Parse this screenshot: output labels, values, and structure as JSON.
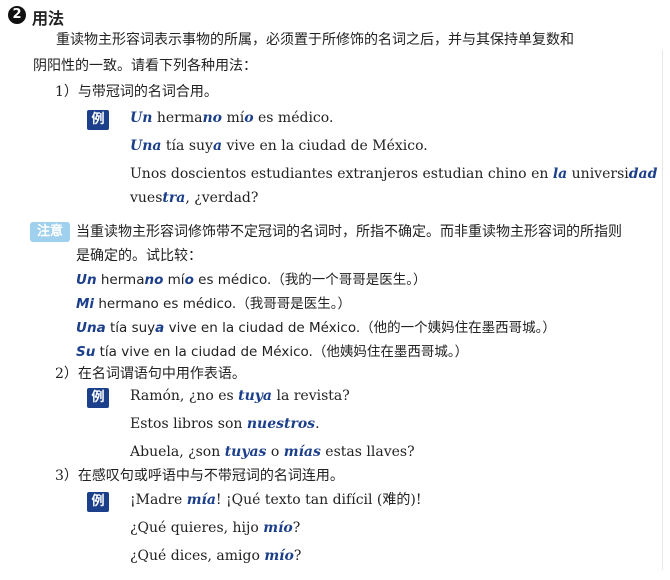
{
  "section": {
    "number": "2",
    "title": "用法"
  },
  "intro": {
    "line1": "重读物主形容词表示事物的所属，必须置于所修饰的名词之后，并与其保持单复数和",
    "line2": "阴阳性的一致。请看下列各种用法："
  },
  "badges": {
    "example": "例",
    "note": "注意"
  },
  "point1": {
    "heading": "1）与带冠词的名词合用。"
  },
  "ex1": {
    "s1": [
      {
        "t": "Un",
        "h": true
      },
      {
        "t": " herma"
      },
      {
        "t": "no",
        "h": true
      },
      {
        "t": " mí"
      },
      {
        "t": "o",
        "h": true
      },
      {
        "t": " es médico."
      }
    ],
    "s2": [
      {
        "t": "Una",
        "h": true
      },
      {
        "t": " tía suy"
      },
      {
        "t": "a",
        "h": true
      },
      {
        "t": " vive en la ciudad de México."
      }
    ],
    "s3a": [
      {
        "t": "Unos doscientos estudiantes extranjeros estudian chino en "
      },
      {
        "t": "la",
        "h": true
      },
      {
        "t": " universi"
      },
      {
        "t": "dad",
        "h": true
      }
    ],
    "s3b": [
      {
        "t": "vues"
      },
      {
        "t": "tra",
        "h": true
      },
      {
        "t": ", ¿verdad?"
      }
    ]
  },
  "note": {
    "line1": "当重读物主形容词修饰带不定冠词的名词时，所指不确定。而非重读物主形容词的所指则",
    "line2": "是确定的。试比较：",
    "c1": [
      {
        "t": "Un",
        "h": true
      },
      {
        "t": " herma"
      },
      {
        "t": "no",
        "h": true
      },
      {
        "t": " mí"
      },
      {
        "t": "o",
        "h": true
      },
      {
        "t": " es médico.（我的一个哥哥是医生。）"
      }
    ],
    "c2": [
      {
        "t": "Mi",
        "h": true
      },
      {
        "t": " hermano es médico.（我哥哥是医生。）"
      }
    ],
    "c3": [
      {
        "t": "Una",
        "h": true
      },
      {
        "t": " tía suy"
      },
      {
        "t": "a",
        "h": true
      },
      {
        "t": " vive en la ciudad de México.（他的一个姨妈住在墨西哥城。）"
      }
    ],
    "c4": [
      {
        "t": "Su",
        "h": true
      },
      {
        "t": " tía vive en la ciudad de México.（他姨妈住在墨西哥城。）"
      }
    ]
  },
  "point2": {
    "heading": "2）在名词谓语句中用作表语。"
  },
  "ex2": {
    "s1": [
      {
        "t": "Ramón, ¿no es "
      },
      {
        "t": "tuya",
        "h": true
      },
      {
        "t": " la revista?"
      }
    ],
    "s2": [
      {
        "t": "Estos libros son "
      },
      {
        "t": "nuestros",
        "h": true
      },
      {
        "t": "."
      }
    ],
    "s3": [
      {
        "t": "Abuela, ¿son "
      },
      {
        "t": "tuyas",
        "h": true
      },
      {
        "t": " o "
      },
      {
        "t": "mías",
        "h": true
      },
      {
        "t": " estas llaves?"
      }
    ]
  },
  "point3": {
    "heading": "3）在感叹句或呼语中与不带冠词的名词连用。"
  },
  "ex3": {
    "s1": [
      {
        "t": "¡Madre "
      },
      {
        "t": "mía",
        "h": true
      },
      {
        "t": "! ¡Qué texto tan difícil (难的)!"
      }
    ],
    "s2": [
      {
        "t": "¿Qué quieres, hijo "
      },
      {
        "t": "mío",
        "h": true
      },
      {
        "t": "?"
      }
    ],
    "s3": [
      {
        "t": "¿Qué dices, amigo "
      },
      {
        "t": "mío",
        "h": true
      },
      {
        "t": "?"
      }
    ]
  }
}
